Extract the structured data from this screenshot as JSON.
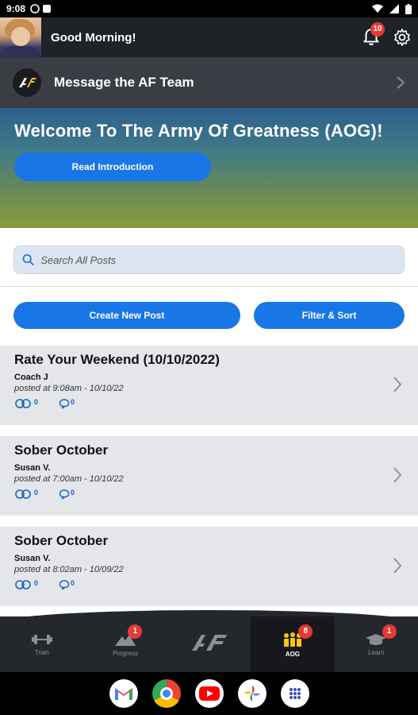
{
  "status_bar": {
    "time": "9:08"
  },
  "header": {
    "greeting": "Good Morning!",
    "notification_count": "10"
  },
  "message_bar": {
    "label": "Message the AF Team"
  },
  "welcome": {
    "title": "Welcome To The Army Of Greatness (AOG)!",
    "button_label": "Read Introduction"
  },
  "search": {
    "placeholder": "Search All Posts"
  },
  "actions": {
    "create_label": "Create New Post",
    "filter_label": "Filter & Sort"
  },
  "posts": [
    {
      "title": "Rate Your Weekend (10/10/2022)",
      "author": "Coach J",
      "date": "posted at 9:08am - 10/10/22",
      "likes": "0",
      "comments": "0"
    },
    {
      "title": "Sober October",
      "author": "Susan V.",
      "date": "posted at 7:00am - 10/10/22",
      "likes": "0",
      "comments": "0"
    },
    {
      "title": "Sober October",
      "author": "Susan V.",
      "date": "posted at 8:02am - 10/09/22",
      "likes": "0",
      "comments": "0"
    }
  ],
  "bottom_nav": [
    {
      "label": "Train",
      "badge": ""
    },
    {
      "label": "Progress",
      "badge": "1"
    },
    {
      "label": "",
      "badge": ""
    },
    {
      "label": "AOG",
      "badge": "8"
    },
    {
      "label": "Learn",
      "badge": "1"
    }
  ],
  "colors": {
    "accent": "#1976e6",
    "header_bg": "#1f2226",
    "badge": "#e53935"
  },
  "icons": [
    "bell-icon",
    "gear-icon",
    "search-icon",
    "chevron-right-icon",
    "like-icon",
    "comment-icon",
    "dumbbell-icon",
    "mountain-icon",
    "af-logo-icon",
    "group-icon",
    "graduation-cap-icon"
  ]
}
